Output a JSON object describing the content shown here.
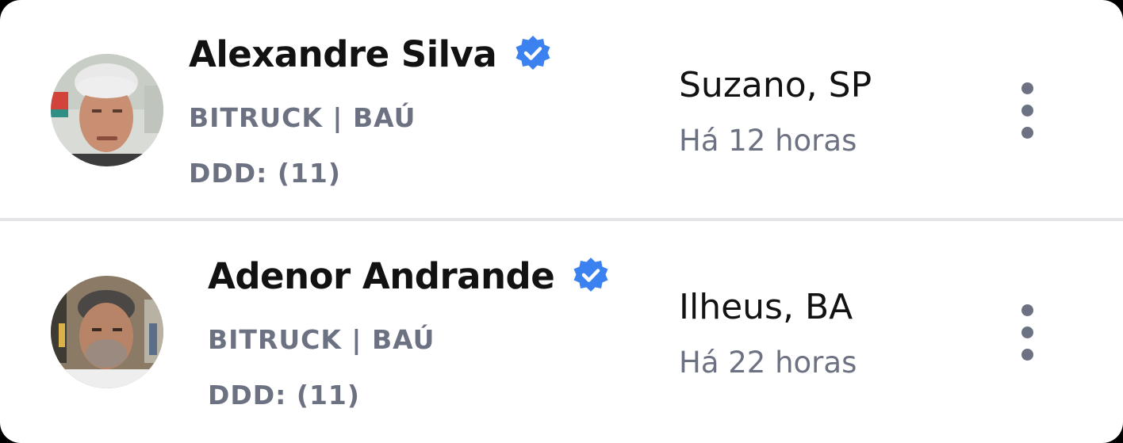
{
  "contacts": [
    {
      "name": "Alexandre Silva",
      "verified_icon": "verified-badge-icon",
      "vehicle": "BITRUCK | BAÚ",
      "ddd": "DDD: (11)",
      "city": "Suzano, SP",
      "time_ago": "Há 12 horas",
      "more_icon": "more-vertical-icon"
    },
    {
      "name": "Adenor Andrande",
      "verified_icon": "verified-badge-icon",
      "vehicle": "BITRUCK | BAÚ",
      "ddd": "DDD: (11)",
      "city": "Ilheus, BA",
      "time_ago": "Há 22 horas",
      "more_icon": "more-vertical-icon"
    }
  ],
  "colors": {
    "verified": "#3b82f0",
    "muted_text": "#6c7282",
    "primary_text": "#121212",
    "divider": "#e3e4e8"
  }
}
